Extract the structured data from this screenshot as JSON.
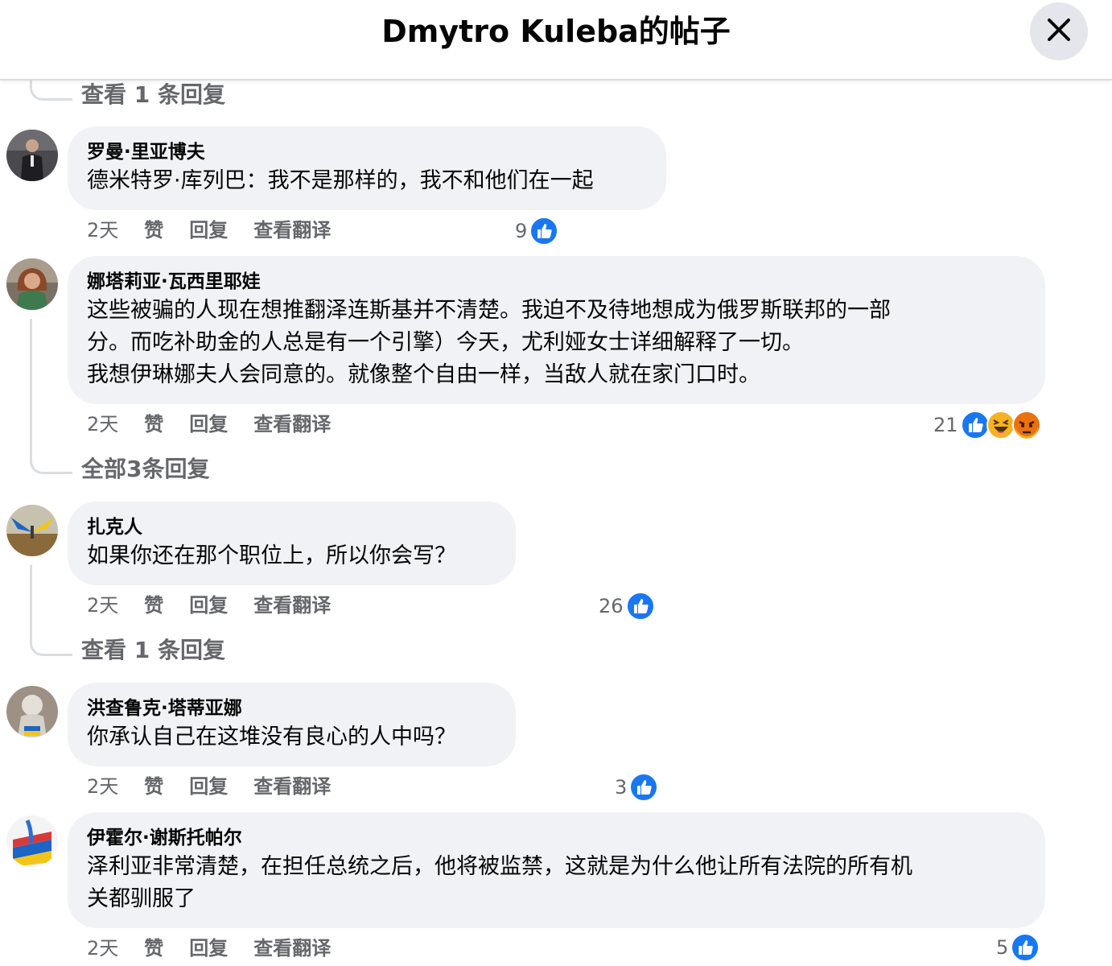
{
  "header": {
    "title": "Dmytro Kuleba的帖子"
  },
  "icons": {
    "close": "close-icon",
    "like": "like-reaction-icon",
    "haha": "haha-reaction-icon",
    "angry": "angry-reaction-icon"
  },
  "colors": {
    "like_blue": "#1877f2",
    "bubble_bg": "#f0f2f5",
    "secondary_text": "#65676b",
    "thread_line": "#dadde1"
  },
  "view_replies_top": "查看 1 条回复",
  "comments": [
    {
      "author": "罗曼·里亚博夫",
      "text": [
        "德米特罗·库列巴：我不是那样的，我不和他们在一起"
      ],
      "time": "2天",
      "like": "赞",
      "reply": "回复",
      "translate": "查看翻译",
      "reaction_count": "9"
    },
    {
      "author": "娜塔莉亚·瓦西里耶娃",
      "text": [
        "这些被骗的人现在想推翻泽连斯基并不清楚。我迫不及待地想成为俄罗斯联邦的一部",
        "分。而吃补助金的人总是有一个引擎）今天，尤利娅女士详细解释了一切。",
        "我想伊琳娜夫人会同意的。就像整个自由一样，当敌人就在家门口时。"
      ],
      "time": "2天",
      "like": "赞",
      "reply": "回复",
      "translate": "查看翻译",
      "reaction_count": "21",
      "view_replies": "全部3条回复"
    },
    {
      "author": "扎克人",
      "text": [
        "如果你还在那个职位上，所以你会写？"
      ],
      "time": "2天",
      "like": "赞",
      "reply": "回复",
      "translate": "查看翻译",
      "reaction_count": "26",
      "view_replies": "查看 1 条回复"
    },
    {
      "author": "洪查鲁克·塔蒂亚娜",
      "text": [
        "你承认自己在这堆没有良心的人中吗？"
      ],
      "time": "2天",
      "like": "赞",
      "reply": "回复",
      "translate": "查看翻译",
      "reaction_count": "3"
    },
    {
      "author": "伊霍尔·谢斯托帕尔",
      "text": [
        "泽利亚非常清楚，在担任总统之后，他将被监禁，这就是为什么他让所有法院的所有机",
        "关都驯服了"
      ],
      "time": "2天",
      "like": "赞",
      "reply": "回复",
      "translate": "查看翻译",
      "reaction_count": "5"
    }
  ]
}
